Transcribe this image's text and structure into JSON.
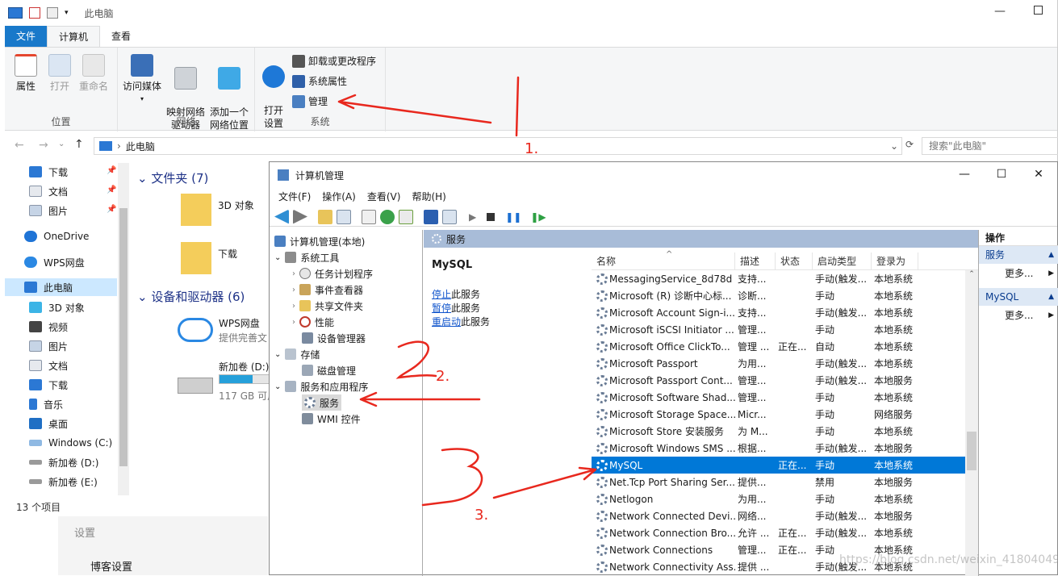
{
  "explorer": {
    "title": "此电脑",
    "tabs": [
      "文件",
      "计算机",
      "查看"
    ],
    "ribbon": {
      "location": {
        "label": "位置",
        "buttons": [
          "属性",
          "打开",
          "重命名"
        ]
      },
      "network": {
        "label": "网络",
        "buttons": [
          "访问媒体",
          "映射网络\n驱动器",
          "添加一个\n网络位置"
        ]
      },
      "system": {
        "label": "系统",
        "open_settings": "打开\n设置",
        "items": [
          "卸载或更改程序",
          "系统属性",
          "管理"
        ]
      }
    },
    "address": "此电脑",
    "search_placeholder": "搜索\"此电脑\"",
    "nav": {
      "quick": [
        "下载",
        "文档",
        "图片"
      ],
      "onedrive": "OneDrive",
      "wps": "WPS网盘",
      "thispc": "此电脑",
      "items": [
        "3D 对象",
        "视频",
        "图片",
        "文档",
        "下载",
        "音乐",
        "桌面",
        "Windows (C:)",
        "新加卷 (D:)",
        "新加卷 (E:)"
      ]
    },
    "content": {
      "folders_header": "文件夹 (7)",
      "folders": [
        "3D 对象",
        "下载"
      ],
      "devices_header": "设备和驱动器 (6)",
      "wps_title": "WPS网盘",
      "wps_sub": "提供完善文",
      "drive_d": "新加卷 (D:)",
      "drive_d_free": "117 GB 可用",
      "drive_d_used_pct": 60
    },
    "status": "13 个项目"
  },
  "background": {
    "settings": "设置",
    "blog": "博客设置"
  },
  "cm": {
    "title": "计算机管理",
    "menu": [
      "文件(F)",
      "操作(A)",
      "查看(V)",
      "帮助(H)"
    ],
    "tree": {
      "root": "计算机管理(本地)",
      "system_tools": "系统工具",
      "children": [
        "任务计划程序",
        "事件查看器",
        "共享文件夹",
        "性能",
        "设备管理器"
      ],
      "storage": "存储",
      "disk": "磁盘管理",
      "services_apps": "服务和应用程序",
      "services": "服务",
      "wmi": "WMI 控件"
    },
    "pane_title": "服务",
    "selected_service": "MySQL",
    "links": [
      {
        "link": "停止",
        "rest": "此服务"
      },
      {
        "link": "暂停",
        "rest": "此服务"
      },
      {
        "link": "重启动",
        "rest": "此服务"
      }
    ],
    "columns": [
      "名称",
      "描述",
      "状态",
      "启动类型",
      "登录为"
    ],
    "rows": [
      [
        "MessagingService_8d78d",
        "支持...",
        "",
        "手动(触发...",
        "本地系统"
      ],
      [
        "Microsoft (R) 诊断中心标...",
        "诊断...",
        "",
        "手动",
        "本地系统"
      ],
      [
        "Microsoft Account Sign-i...",
        "支持...",
        "",
        "手动(触发...",
        "本地系统"
      ],
      [
        "Microsoft iSCSI Initiator ...",
        "管理...",
        "",
        "手动",
        "本地系统"
      ],
      [
        "Microsoft Office ClickTo...",
        "管理 ...",
        "正在...",
        "自动",
        "本地系统"
      ],
      [
        "Microsoft Passport",
        "为用...",
        "",
        "手动(触发...",
        "本地系统"
      ],
      [
        "Microsoft Passport Cont...",
        "管理...",
        "",
        "手动(触发...",
        "本地服务"
      ],
      [
        "Microsoft Software Shad...",
        "管理...",
        "",
        "手动",
        "本地系统"
      ],
      [
        "Microsoft Storage Space...",
        "Micr...",
        "",
        "手动",
        "网络服务"
      ],
      [
        "Microsoft Store 安装服务",
        "为 M...",
        "",
        "手动",
        "本地系统"
      ],
      [
        "Microsoft Windows SMS ...",
        "根据...",
        "",
        "手动(触发...",
        "本地服务"
      ],
      [
        "MySQL",
        "",
        "正在...",
        "手动",
        "本地系统"
      ],
      [
        "Net.Tcp Port Sharing Ser...",
        "提供...",
        "",
        "禁用",
        "本地服务"
      ],
      [
        "Netlogon",
        "为用...",
        "",
        "手动",
        "本地系统"
      ],
      [
        "Network Connected Devi...",
        "网络...",
        "",
        "手动(触发...",
        "本地服务"
      ],
      [
        "Network Connection Bro...",
        "允许 ...",
        "正在...",
        "手动(触发...",
        "本地系统"
      ],
      [
        "Network Connections",
        "管理...",
        "正在...",
        "手动",
        "本地系统"
      ],
      [
        "Network Connectivity Ass...",
        "提供 ...",
        "",
        "手动(触发...",
        "本地系统"
      ]
    ],
    "selected_row_index": 11,
    "actions": {
      "title": "操作",
      "sections": [
        "服务",
        "MySQL"
      ],
      "more": "更多..."
    }
  },
  "watermark": "https://blog.csdn.net/weixin_41804049",
  "annotations": [
    "1.",
    "2.",
    "3."
  ]
}
